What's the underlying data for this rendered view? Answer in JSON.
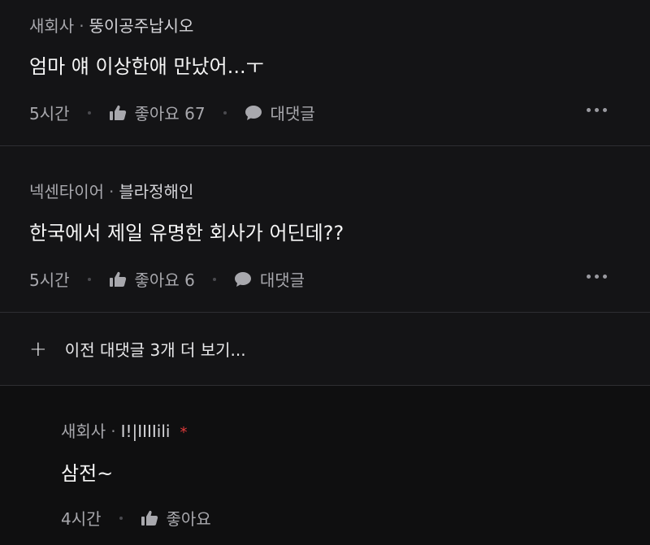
{
  "comments": [
    {
      "company": "새회사",
      "nickname": "뚱이공주납시오",
      "text": "엄마 얘 이상한애 만났어...ㅜ",
      "time": "5시간",
      "like_label": "좋아요 67",
      "reply_label": "대댓글"
    },
    {
      "company": "넥센타이어",
      "nickname": "블라정해인",
      "text": "한국에서 제일 유명한 회사가 어딘데??",
      "time": "5시간",
      "like_label": "좋아요 6",
      "reply_label": "대댓글"
    }
  ],
  "expand": {
    "label": "이전 대댓글 3개 더 보기..."
  },
  "reply": {
    "company": "새회사",
    "nickname": "I!|IIIIili",
    "author_mark": "*",
    "text": "삼전~",
    "time": "4시간",
    "like_label": "좋아요"
  },
  "separator": "·",
  "colors": {
    "background": "#141416",
    "reply_background": "#0f0f10",
    "author_mark": "#e03a3a"
  },
  "icons": [
    "thumbs-up-icon",
    "speech-bubble-icon",
    "more-dots-icon",
    "plus-icon"
  ]
}
